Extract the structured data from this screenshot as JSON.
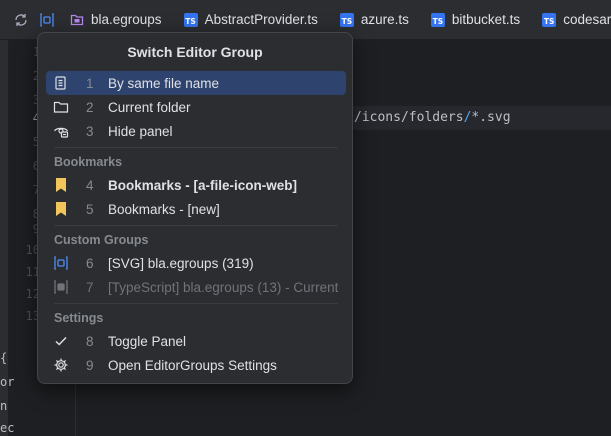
{
  "tabbar": {
    "tabs": [
      {
        "label": "bla.egroups",
        "icon": "folder-icon"
      },
      {
        "label": "AbstractProvider.ts",
        "icon": "typescript-icon"
      },
      {
        "label": "azure.ts",
        "icon": "typescript-icon"
      },
      {
        "label": "bitbucket.ts",
        "icon": "typescript-icon"
      },
      {
        "label": "codesar",
        "icon": "typescript-icon"
      }
    ],
    "ts_badge": "TS"
  },
  "editor": {
    "line_numbers": [
      "1",
      "2",
      "3",
      "4",
      "5",
      "6",
      "7",
      "8",
      "9",
      "10",
      "11",
      "12",
      "13"
    ],
    "code_line_4_prefix": "/icons/folders",
    "code_line_4_sep": "/",
    "code_line_4_suffix": "*.svg",
    "edge_chars": [
      "{",
      "or",
      "n",
      "ec"
    ]
  },
  "popup": {
    "title": "Switch Editor Group",
    "items": [
      {
        "num": "1",
        "label": "By same file name",
        "icon": "file-list-icon"
      },
      {
        "num": "2",
        "label": "Current folder",
        "icon": "folder-outline-icon"
      },
      {
        "num": "3",
        "label": "Hide panel",
        "icon": "hide-eye-icon"
      }
    ],
    "sections": {
      "bookmarks": "Bookmarks",
      "custom": "Custom Groups",
      "settings": "Settings"
    },
    "bookmarks": [
      {
        "num": "4",
        "label": "Bookmarks - [a-file-icon-web]",
        "icon": "bookmark-icon"
      },
      {
        "num": "5",
        "label": "Bookmarks - [new]",
        "icon": "bookmark-icon"
      }
    ],
    "custom": [
      {
        "num": "6",
        "label": "[SVG] bla.egroups (319)",
        "icon": "editor-group-icon"
      },
      {
        "num": "7",
        "label": "[TypeScript] bla.egroups (13) - Current",
        "icon": "editor-group-icon"
      }
    ],
    "settings": [
      {
        "num": "8",
        "label": "Toggle Panel",
        "icon": "checkmark-icon"
      },
      {
        "num": "9",
        "label": "Open EditorGroups Settings",
        "icon": "gear-icon"
      }
    ]
  },
  "colors": {
    "selection": "#2e436e",
    "bookmark": "#f2c55c",
    "accent_blue": "#3574f0",
    "folder_purple": "#b589ec"
  }
}
